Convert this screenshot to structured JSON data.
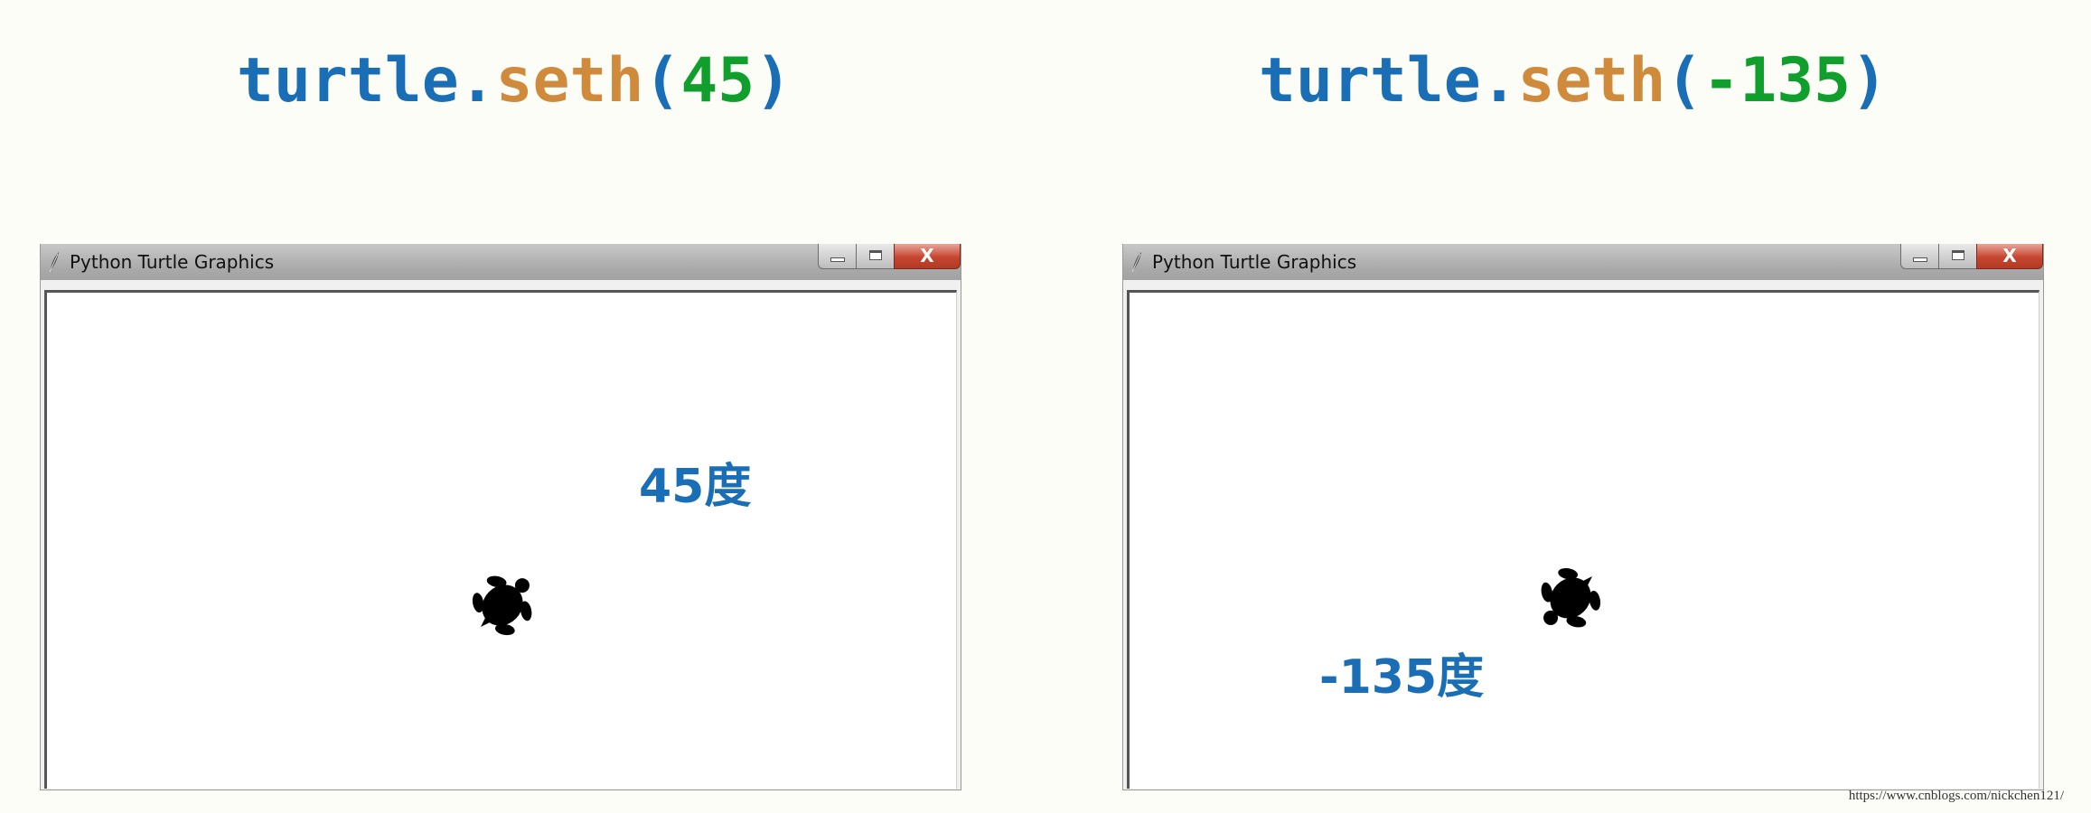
{
  "colors": {
    "blue": "#1a6eb5",
    "orange": "#cf8a3c",
    "green": "#109f2c"
  },
  "panels": [
    {
      "code": {
        "module": "turtle",
        "dot": ".",
        "func": "seth",
        "open": "(",
        "arg": "45",
        "close": ")"
      },
      "window": {
        "title": "Python Turtle Graphics",
        "close_label": "X"
      },
      "annotation": "45度",
      "heading_deg": 45
    },
    {
      "code": {
        "module": "turtle",
        "dot": ".",
        "func": "seth",
        "open": "(",
        "arg": "-135",
        "close": ")"
      },
      "window": {
        "title": "Python Turtle Graphics",
        "close_label": "X"
      },
      "annotation": "-135度",
      "heading_deg": -135
    }
  ],
  "watermark": "https://www.cnblogs.com/nickchen121/"
}
